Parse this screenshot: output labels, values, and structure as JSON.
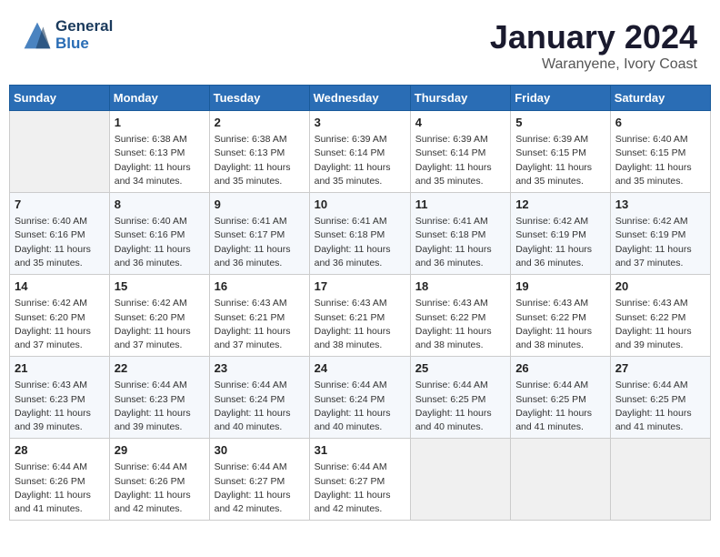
{
  "header": {
    "logo_line1": "General",
    "logo_line2": "Blue",
    "month": "January 2024",
    "location": "Waranyene, Ivory Coast"
  },
  "days_of_week": [
    "Sunday",
    "Monday",
    "Tuesday",
    "Wednesday",
    "Thursday",
    "Friday",
    "Saturday"
  ],
  "weeks": [
    [
      {
        "day": "",
        "info": ""
      },
      {
        "day": "1",
        "info": "Sunrise: 6:38 AM\nSunset: 6:13 PM\nDaylight: 11 hours\nand 34 minutes."
      },
      {
        "day": "2",
        "info": "Sunrise: 6:38 AM\nSunset: 6:13 PM\nDaylight: 11 hours\nand 35 minutes."
      },
      {
        "day": "3",
        "info": "Sunrise: 6:39 AM\nSunset: 6:14 PM\nDaylight: 11 hours\nand 35 minutes."
      },
      {
        "day": "4",
        "info": "Sunrise: 6:39 AM\nSunset: 6:14 PM\nDaylight: 11 hours\nand 35 minutes."
      },
      {
        "day": "5",
        "info": "Sunrise: 6:39 AM\nSunset: 6:15 PM\nDaylight: 11 hours\nand 35 minutes."
      },
      {
        "day": "6",
        "info": "Sunrise: 6:40 AM\nSunset: 6:15 PM\nDaylight: 11 hours\nand 35 minutes."
      }
    ],
    [
      {
        "day": "7",
        "info": "Sunrise: 6:40 AM\nSunset: 6:16 PM\nDaylight: 11 hours\nand 35 minutes."
      },
      {
        "day": "8",
        "info": "Sunrise: 6:40 AM\nSunset: 6:16 PM\nDaylight: 11 hours\nand 36 minutes."
      },
      {
        "day": "9",
        "info": "Sunrise: 6:41 AM\nSunset: 6:17 PM\nDaylight: 11 hours\nand 36 minutes."
      },
      {
        "day": "10",
        "info": "Sunrise: 6:41 AM\nSunset: 6:18 PM\nDaylight: 11 hours\nand 36 minutes."
      },
      {
        "day": "11",
        "info": "Sunrise: 6:41 AM\nSunset: 6:18 PM\nDaylight: 11 hours\nand 36 minutes."
      },
      {
        "day": "12",
        "info": "Sunrise: 6:42 AM\nSunset: 6:19 PM\nDaylight: 11 hours\nand 36 minutes."
      },
      {
        "day": "13",
        "info": "Sunrise: 6:42 AM\nSunset: 6:19 PM\nDaylight: 11 hours\nand 37 minutes."
      }
    ],
    [
      {
        "day": "14",
        "info": "Sunrise: 6:42 AM\nSunset: 6:20 PM\nDaylight: 11 hours\nand 37 minutes."
      },
      {
        "day": "15",
        "info": "Sunrise: 6:42 AM\nSunset: 6:20 PM\nDaylight: 11 hours\nand 37 minutes."
      },
      {
        "day": "16",
        "info": "Sunrise: 6:43 AM\nSunset: 6:21 PM\nDaylight: 11 hours\nand 37 minutes."
      },
      {
        "day": "17",
        "info": "Sunrise: 6:43 AM\nSunset: 6:21 PM\nDaylight: 11 hours\nand 38 minutes."
      },
      {
        "day": "18",
        "info": "Sunrise: 6:43 AM\nSunset: 6:22 PM\nDaylight: 11 hours\nand 38 minutes."
      },
      {
        "day": "19",
        "info": "Sunrise: 6:43 AM\nSunset: 6:22 PM\nDaylight: 11 hours\nand 38 minutes."
      },
      {
        "day": "20",
        "info": "Sunrise: 6:43 AM\nSunset: 6:22 PM\nDaylight: 11 hours\nand 39 minutes."
      }
    ],
    [
      {
        "day": "21",
        "info": "Sunrise: 6:43 AM\nSunset: 6:23 PM\nDaylight: 11 hours\nand 39 minutes."
      },
      {
        "day": "22",
        "info": "Sunrise: 6:44 AM\nSunset: 6:23 PM\nDaylight: 11 hours\nand 39 minutes."
      },
      {
        "day": "23",
        "info": "Sunrise: 6:44 AM\nSunset: 6:24 PM\nDaylight: 11 hours\nand 40 minutes."
      },
      {
        "day": "24",
        "info": "Sunrise: 6:44 AM\nSunset: 6:24 PM\nDaylight: 11 hours\nand 40 minutes."
      },
      {
        "day": "25",
        "info": "Sunrise: 6:44 AM\nSunset: 6:25 PM\nDaylight: 11 hours\nand 40 minutes."
      },
      {
        "day": "26",
        "info": "Sunrise: 6:44 AM\nSunset: 6:25 PM\nDaylight: 11 hours\nand 41 minutes."
      },
      {
        "day": "27",
        "info": "Sunrise: 6:44 AM\nSunset: 6:25 PM\nDaylight: 11 hours\nand 41 minutes."
      }
    ],
    [
      {
        "day": "28",
        "info": "Sunrise: 6:44 AM\nSunset: 6:26 PM\nDaylight: 11 hours\nand 41 minutes."
      },
      {
        "day": "29",
        "info": "Sunrise: 6:44 AM\nSunset: 6:26 PM\nDaylight: 11 hours\nand 42 minutes."
      },
      {
        "day": "30",
        "info": "Sunrise: 6:44 AM\nSunset: 6:27 PM\nDaylight: 11 hours\nand 42 minutes."
      },
      {
        "day": "31",
        "info": "Sunrise: 6:44 AM\nSunset: 6:27 PM\nDaylight: 11 hours\nand 42 minutes."
      },
      {
        "day": "",
        "info": ""
      },
      {
        "day": "",
        "info": ""
      },
      {
        "day": "",
        "info": ""
      }
    ]
  ]
}
